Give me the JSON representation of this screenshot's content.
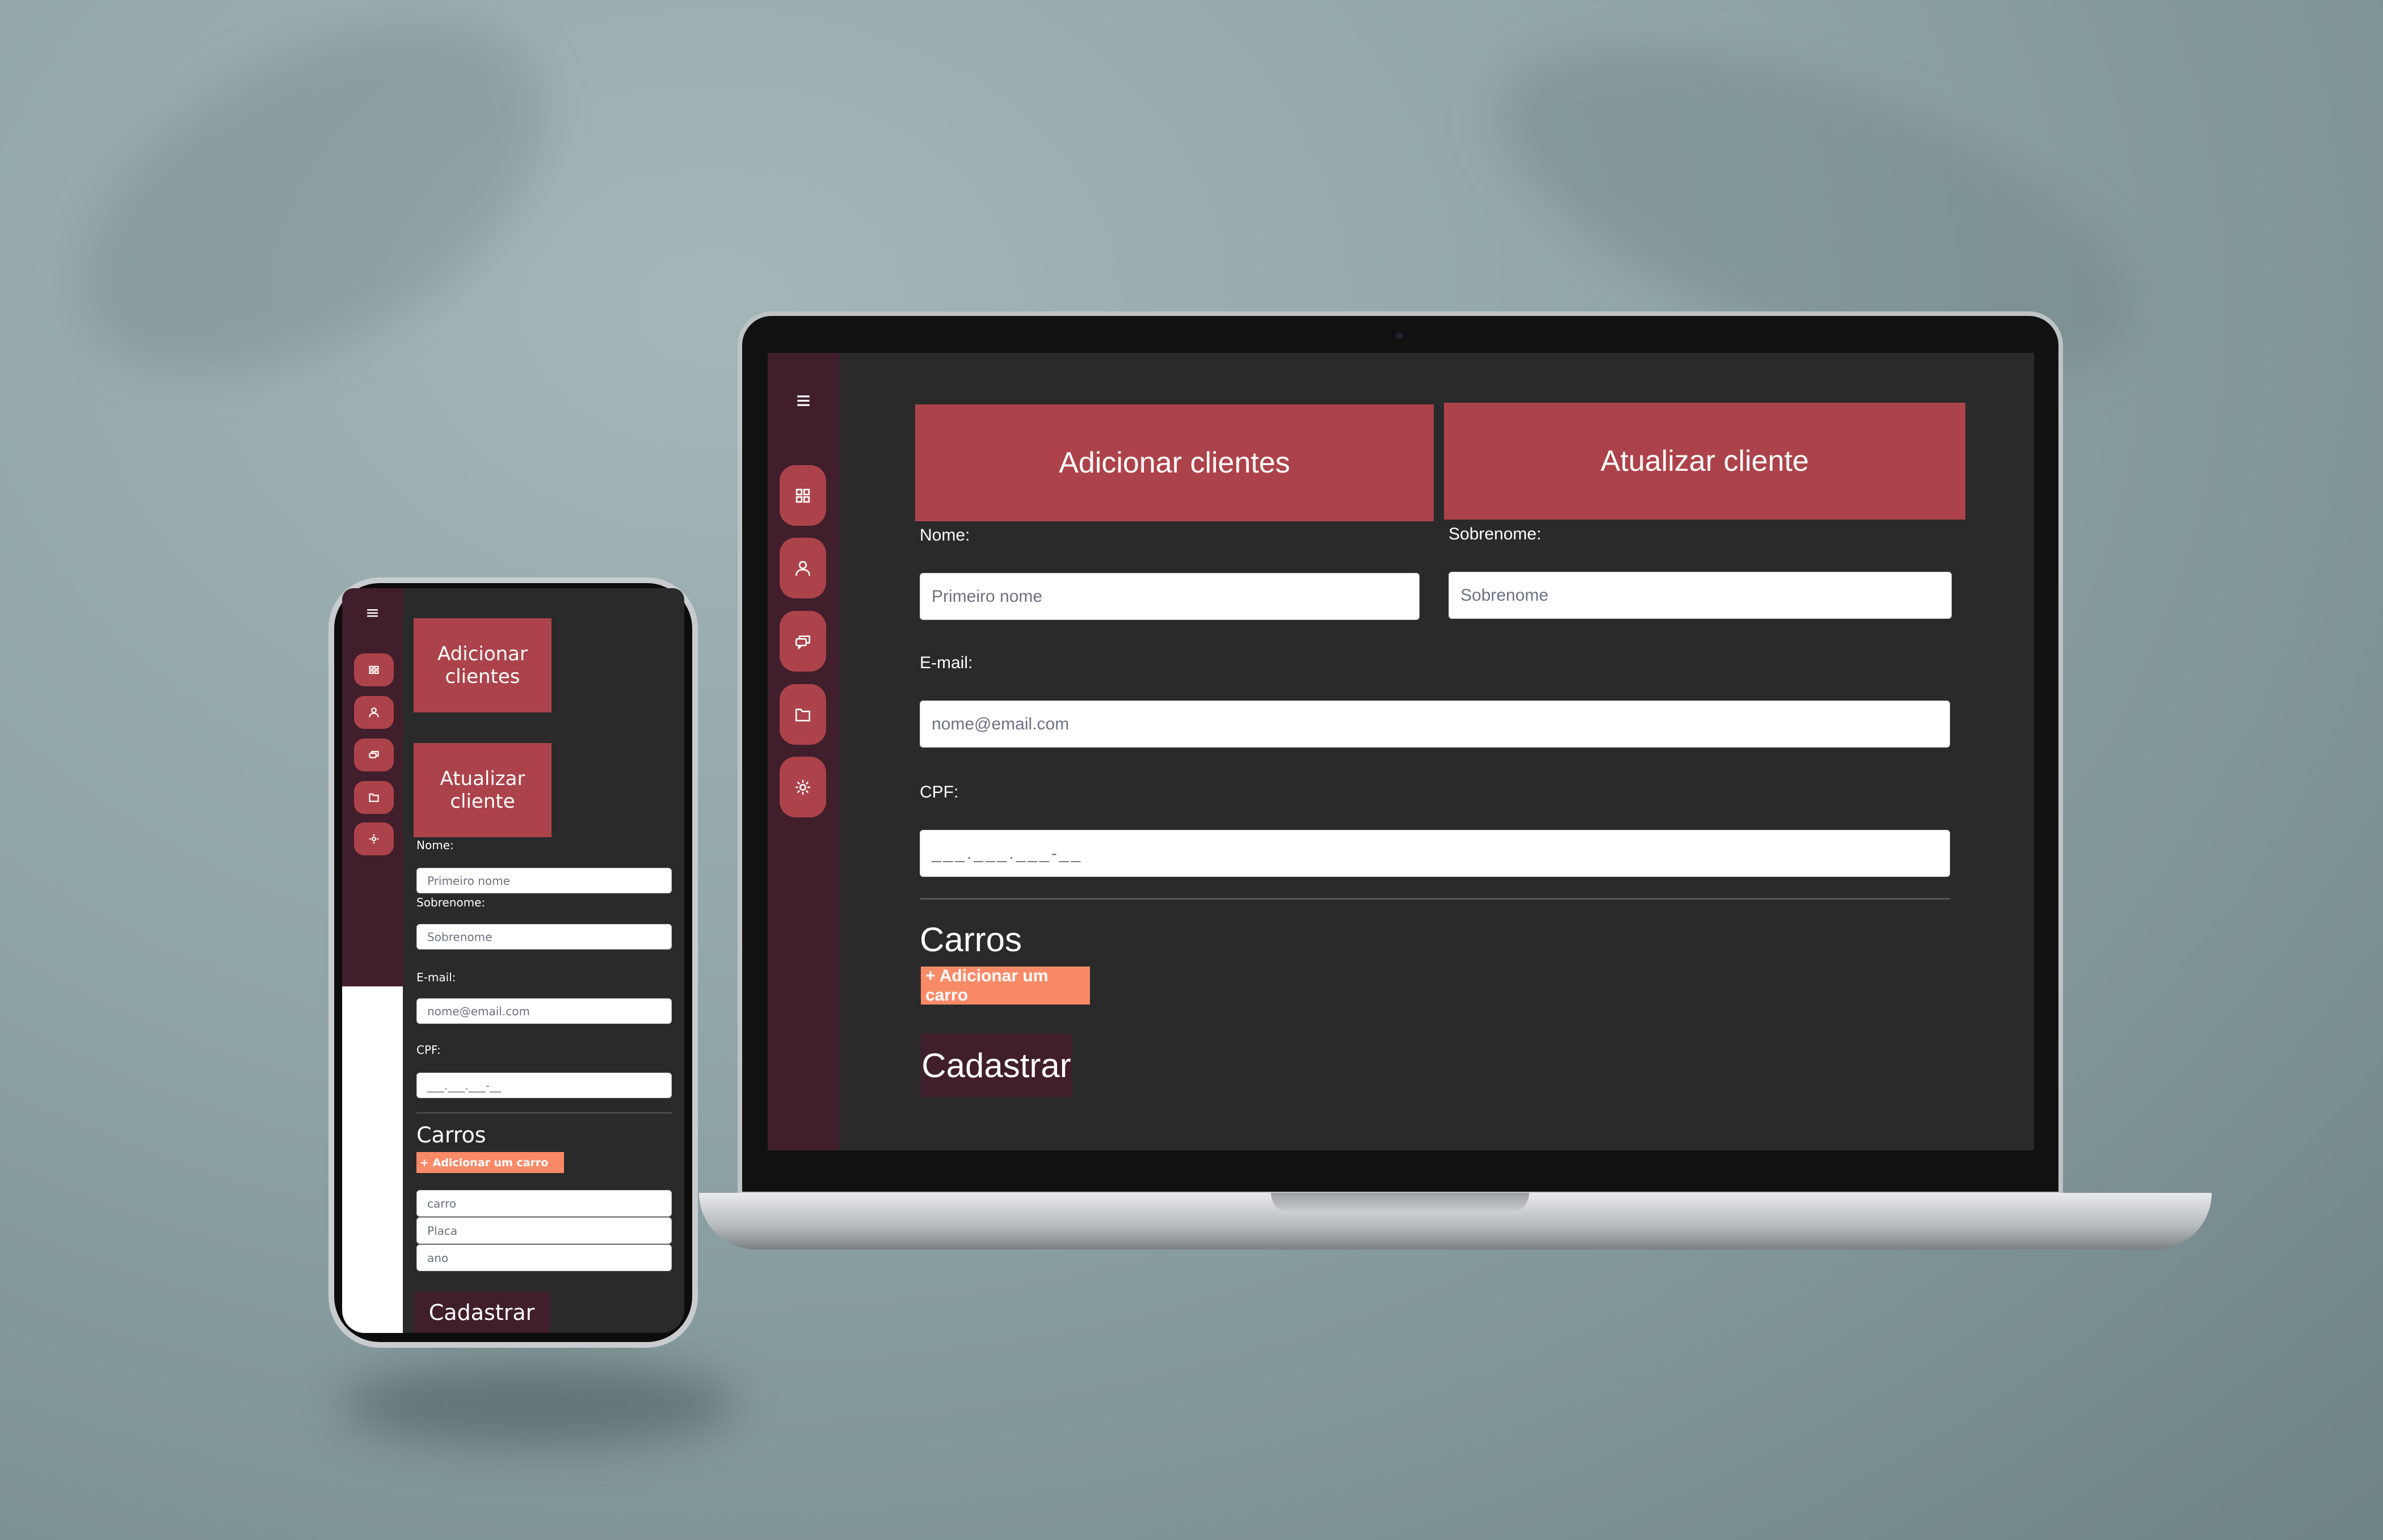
{
  "sidebar": {
    "icons": [
      "menu-icon",
      "grid-icon",
      "user-icon",
      "chat-icon",
      "folder-icon",
      "gear-icon"
    ]
  },
  "header": {
    "add_clients": "Adicionar clientes",
    "update_client": "Atualizar cliente"
  },
  "form": {
    "nome_label": "Nome:",
    "nome_placeholder": "Primeiro nome",
    "sobrenome_label": "Sobrenome:",
    "sobrenome_placeholder": "Sobrenome",
    "email_label": "E-mail:",
    "email_placeholder": "nome@email.com",
    "cpf_label": "CPF:",
    "cpf_placeholder": "___.___.___-__"
  },
  "cars": {
    "title": "Carros",
    "add_button": "+ Adicionar um carro",
    "fields": [
      "carro",
      "Placa",
      "ano"
    ]
  },
  "submit": "Cadastrar",
  "phone": {
    "add_clients": "Adicionar clientes",
    "update_client": "Atualizar cliente"
  },
  "colors": {
    "accent": "#ad434a",
    "sidebar": "#401e2b",
    "background": "#2a2a2a",
    "orange": "#f98a68"
  }
}
